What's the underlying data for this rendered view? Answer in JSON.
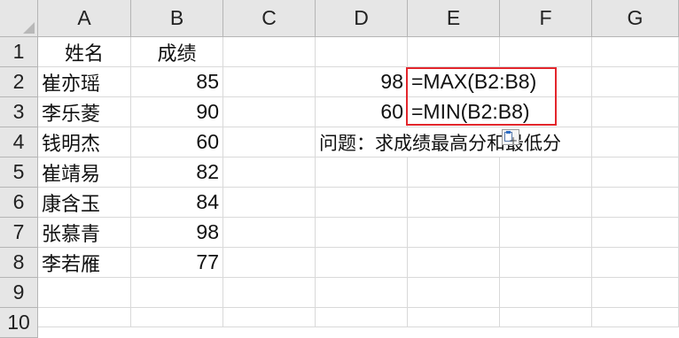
{
  "columns": [
    "A",
    "B",
    "C",
    "D",
    "E",
    "F",
    "G"
  ],
  "rows": [
    "1",
    "2",
    "3",
    "4",
    "5",
    "6",
    "7",
    "8",
    "9",
    "10"
  ],
  "header": {
    "name": "姓名",
    "score": "成绩"
  },
  "students": [
    {
      "name": "崔亦瑶",
      "score": "85"
    },
    {
      "name": "李乐菱",
      "score": "90"
    },
    {
      "name": "钱明杰",
      "score": "60"
    },
    {
      "name": "崔靖易",
      "score": "82"
    },
    {
      "name": "康含玉",
      "score": "84"
    },
    {
      "name": "张慕青",
      "score": "98"
    },
    {
      "name": "李若雁",
      "score": "77"
    }
  ],
  "results": {
    "max_value": "98",
    "max_formula": "=MAX(B2:B8)",
    "min_value": "60",
    "min_formula": "=MIN(B2:B8)"
  },
  "question": "问题：求成绩最高分和最低分",
  "colors": {
    "highlight": "#e3262c",
    "header_bg": "#e6e6e6",
    "grid": "#d9d9d9"
  },
  "icons": {
    "paste_options": "paste-options-icon"
  }
}
